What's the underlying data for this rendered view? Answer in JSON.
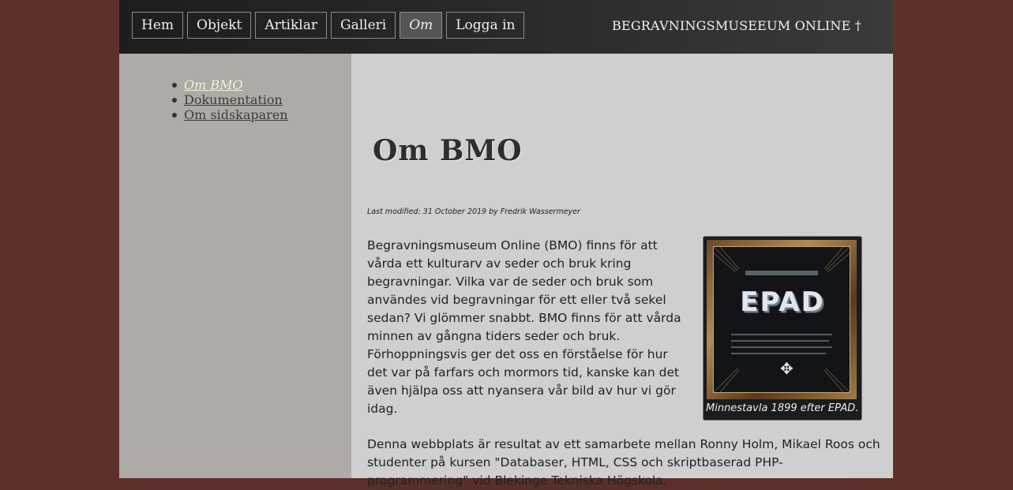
{
  "nav": {
    "items": [
      {
        "label": "Hem"
      },
      {
        "label": "Objekt"
      },
      {
        "label": "Artiklar"
      },
      {
        "label": "Galleri"
      },
      {
        "label": "Om",
        "active": true
      },
      {
        "label": "Logga in"
      }
    ]
  },
  "site_title": "BEGRAVNINGSMUSEEUM ONLINE †",
  "sidebar": {
    "items": [
      {
        "label": "Om BMO",
        "current": true
      },
      {
        "label": "Dokumentation"
      },
      {
        "label": "Om sidskaparen"
      }
    ]
  },
  "main": {
    "title": "Om BMO",
    "meta": "Last modified: 31 October 2019 by Fredrik Wassermeyer",
    "paragraph1": "Begravningsmuseum Online (BMO) finns för att vårda ett kulturarv av seder och bruk kring begravningar. Vilka var de seder och bruk som användes vid begravningar för ett eller två sekel sedan? Vi glömmer snabbt. BMO finns för att vårda minnen av gångna tiders seder och bruk. Förhoppningsvis ger det oss en förståelse för hur det var på farfars och mormors tid, kanske kan det även hjälpa oss att nyansera vår bild av hur vi gör idag.",
    "paragraph2": "Denna webbplats är resultat av ett samarbete mellan Ronny Holm, Mikael Roos och studenter på kursen \"Databaser, HTML, CSS och skriptbaserad PHP-programmering\" vid Blekinge Tekniska Högskola.",
    "figure": {
      "image_text": "EPAD",
      "caption": "Minnestavla 1899 efter EPAD."
    }
  },
  "colors": {
    "background": "#5b2f2c",
    "content_bg": "#cfcfcf",
    "sidebar_bg": "#adaaa8",
    "topbar_bg": "#2b2b2b",
    "active_link": "#f4f0d4"
  }
}
